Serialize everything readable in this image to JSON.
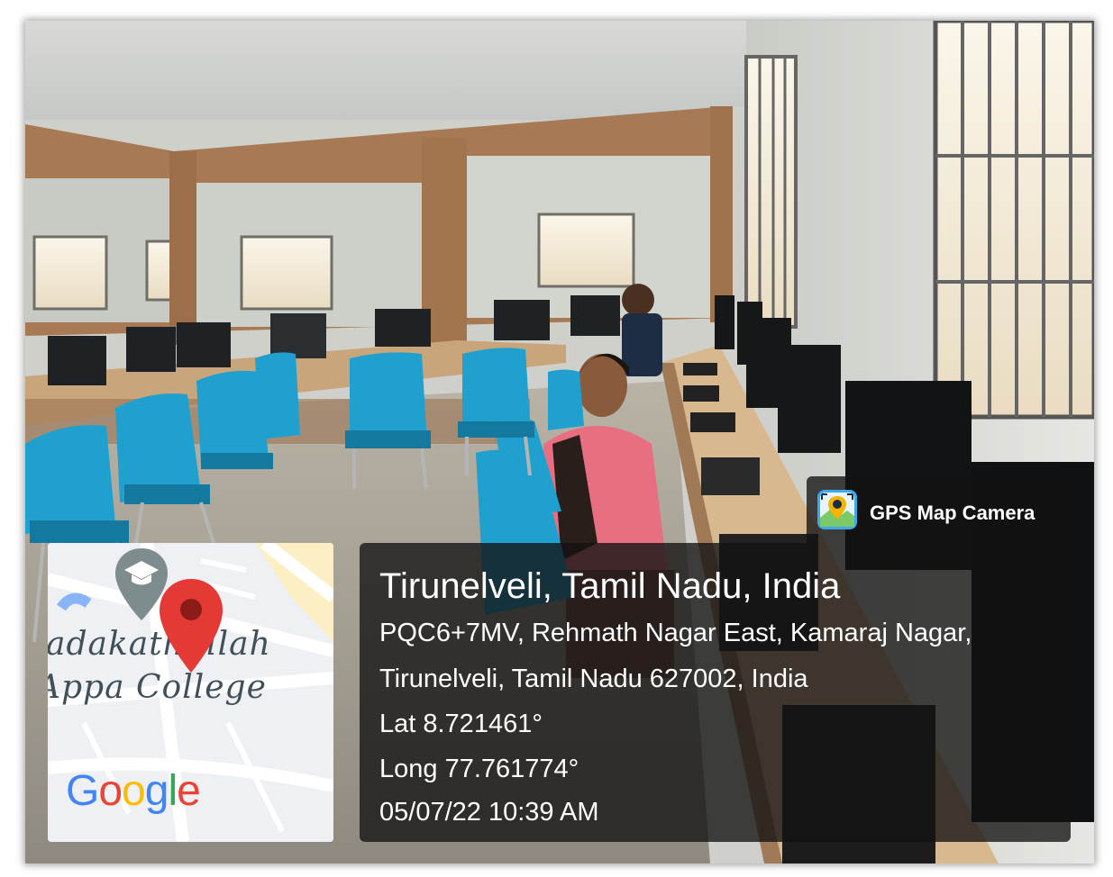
{
  "map": {
    "campus_line1": "adakathullah",
    "campus_line2": "Appa College",
    "logo": [
      "G",
      "o",
      "o",
      "g",
      "l",
      "e"
    ],
    "logo_colors": [
      "#4285F4",
      "#EA4335",
      "#FBBC05",
      "#4285F4",
      "#34A853",
      "#EA4335"
    ],
    "pin_icon": "map-pin-icon",
    "school_icon": "graduation-cap-icon"
  },
  "info": {
    "title": "Tirunelveli, Tamil Nadu, India",
    "address_line1": "PQC6+7MV, Rehmath Nagar East, Kamaraj Nagar,",
    "address_line2": "Tirunelveli, Tamil Nadu 627002, India",
    "latitude": "Lat 8.721461°",
    "longitude": "Long 77.761774°",
    "datetime": "05/07/22 10:39 AM"
  },
  "badge": {
    "app_name": "GPS Map Camera",
    "icon": "gps-camera-icon"
  },
  "colors": {
    "chair_blue": "#1fa0cf",
    "wood_panel": "#a77a55",
    "pin_red": "#e53935"
  }
}
